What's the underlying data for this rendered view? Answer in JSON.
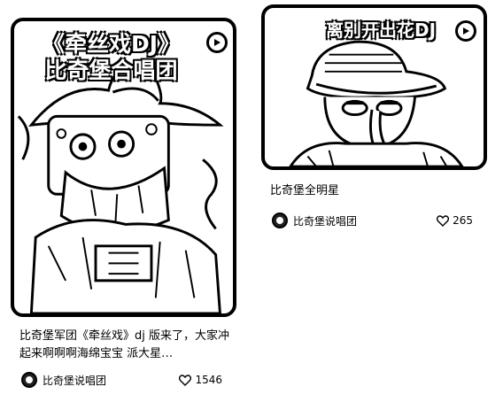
{
  "cards": [
    {
      "cover_title_line1": "《牵丝戏DJ》",
      "cover_title_line2": "比奇堡合唱团",
      "caption": "比奇堡军团《牵丝戏》dj 版来了，大家冲起来啊啊啊海绵宝宝 派大星…",
      "author": "比奇堡说唱团",
      "likes": "1546",
      "play_icon": "play-circle-icon",
      "like_icon": "heart-outline-icon"
    },
    {
      "cover_title_line1": "离别开出花DJ",
      "caption": "比奇堡全明星",
      "author": "比奇堡说唱团",
      "likes": "265",
      "play_icon": "play-circle-icon",
      "like_icon": "heart-outline-icon"
    }
  ]
}
